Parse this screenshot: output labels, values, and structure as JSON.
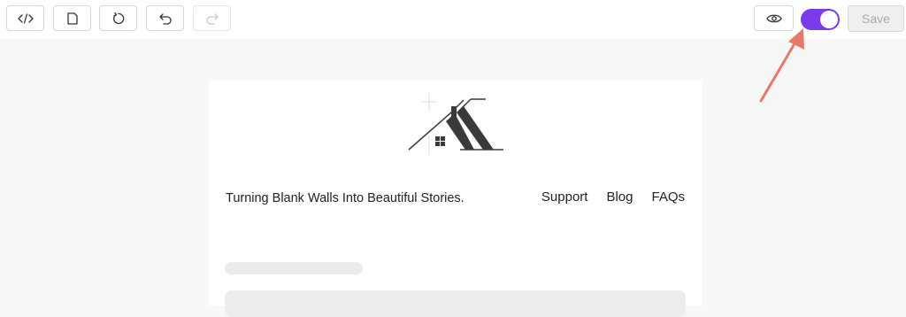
{
  "toolbar": {
    "buttons": [
      {
        "icon": "code-icon"
      },
      {
        "icon": "document-icon"
      },
      {
        "icon": "reset-icon"
      },
      {
        "icon": "undo-icon"
      },
      {
        "icon": "redo-icon",
        "disabled": true
      }
    ],
    "preview_icon": "eye-icon",
    "toggle": {
      "on": true,
      "color": "#7c3aed"
    },
    "save_label": "Save"
  },
  "page": {
    "logo_icon": "house-roof-logo",
    "tagline": "Turning Blank Walls Into Beautiful Stories.",
    "nav": [
      "Support",
      "Blog",
      "FAQs"
    ]
  },
  "annotation": {
    "arrow_color": "#e8786a"
  }
}
